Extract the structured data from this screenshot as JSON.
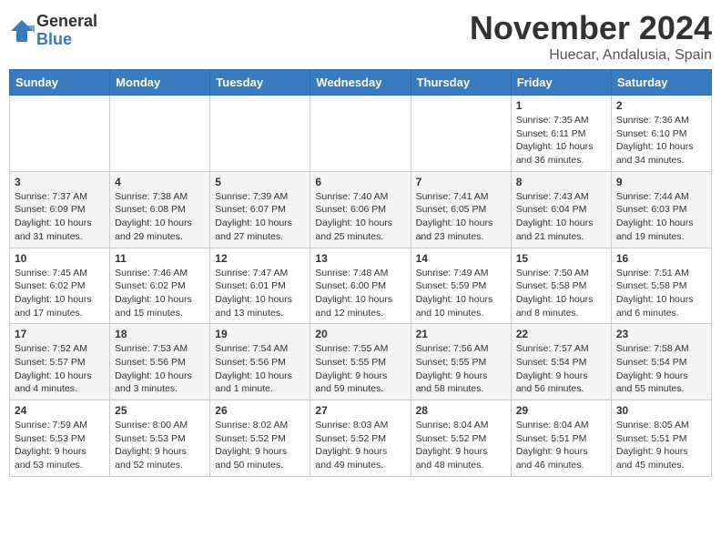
{
  "header": {
    "logo_general": "General",
    "logo_blue": "Blue",
    "month": "November 2024",
    "location": "Huecar, Andalusia, Spain"
  },
  "days_of_week": [
    "Sunday",
    "Monday",
    "Tuesday",
    "Wednesday",
    "Thursday",
    "Friday",
    "Saturday"
  ],
  "weeks": [
    [
      {
        "day": "",
        "info": ""
      },
      {
        "day": "",
        "info": ""
      },
      {
        "day": "",
        "info": ""
      },
      {
        "day": "",
        "info": ""
      },
      {
        "day": "",
        "info": ""
      },
      {
        "day": "1",
        "info": "Sunrise: 7:35 AM\nSunset: 6:11 PM\nDaylight: 10 hours and 36 minutes."
      },
      {
        "day": "2",
        "info": "Sunrise: 7:36 AM\nSunset: 6:10 PM\nDaylight: 10 hours and 34 minutes."
      }
    ],
    [
      {
        "day": "3",
        "info": "Sunrise: 7:37 AM\nSunset: 6:09 PM\nDaylight: 10 hours and 31 minutes."
      },
      {
        "day": "4",
        "info": "Sunrise: 7:38 AM\nSunset: 6:08 PM\nDaylight: 10 hours and 29 minutes."
      },
      {
        "day": "5",
        "info": "Sunrise: 7:39 AM\nSunset: 6:07 PM\nDaylight: 10 hours and 27 minutes."
      },
      {
        "day": "6",
        "info": "Sunrise: 7:40 AM\nSunset: 6:06 PM\nDaylight: 10 hours and 25 minutes."
      },
      {
        "day": "7",
        "info": "Sunrise: 7:41 AM\nSunset: 6:05 PM\nDaylight: 10 hours and 23 minutes."
      },
      {
        "day": "8",
        "info": "Sunrise: 7:43 AM\nSunset: 6:04 PM\nDaylight: 10 hours and 21 minutes."
      },
      {
        "day": "9",
        "info": "Sunrise: 7:44 AM\nSunset: 6:03 PM\nDaylight: 10 hours and 19 minutes."
      }
    ],
    [
      {
        "day": "10",
        "info": "Sunrise: 7:45 AM\nSunset: 6:02 PM\nDaylight: 10 hours and 17 minutes."
      },
      {
        "day": "11",
        "info": "Sunrise: 7:46 AM\nSunset: 6:02 PM\nDaylight: 10 hours and 15 minutes."
      },
      {
        "day": "12",
        "info": "Sunrise: 7:47 AM\nSunset: 6:01 PM\nDaylight: 10 hours and 13 minutes."
      },
      {
        "day": "13",
        "info": "Sunrise: 7:48 AM\nSunset: 6:00 PM\nDaylight: 10 hours and 12 minutes."
      },
      {
        "day": "14",
        "info": "Sunrise: 7:49 AM\nSunset: 5:59 PM\nDaylight: 10 hours and 10 minutes."
      },
      {
        "day": "15",
        "info": "Sunrise: 7:50 AM\nSunset: 5:58 PM\nDaylight: 10 hours and 8 minutes."
      },
      {
        "day": "16",
        "info": "Sunrise: 7:51 AM\nSunset: 5:58 PM\nDaylight: 10 hours and 6 minutes."
      }
    ],
    [
      {
        "day": "17",
        "info": "Sunrise: 7:52 AM\nSunset: 5:57 PM\nDaylight: 10 hours and 4 minutes."
      },
      {
        "day": "18",
        "info": "Sunrise: 7:53 AM\nSunset: 5:56 PM\nDaylight: 10 hours and 3 minutes."
      },
      {
        "day": "19",
        "info": "Sunrise: 7:54 AM\nSunset: 5:56 PM\nDaylight: 10 hours and 1 minute."
      },
      {
        "day": "20",
        "info": "Sunrise: 7:55 AM\nSunset: 5:55 PM\nDaylight: 9 hours and 59 minutes."
      },
      {
        "day": "21",
        "info": "Sunrise: 7:56 AM\nSunset: 5:55 PM\nDaylight: 9 hours and 58 minutes."
      },
      {
        "day": "22",
        "info": "Sunrise: 7:57 AM\nSunset: 5:54 PM\nDaylight: 9 hours and 56 minutes."
      },
      {
        "day": "23",
        "info": "Sunrise: 7:58 AM\nSunset: 5:54 PM\nDaylight: 9 hours and 55 minutes."
      }
    ],
    [
      {
        "day": "24",
        "info": "Sunrise: 7:59 AM\nSunset: 5:53 PM\nDaylight: 9 hours and 53 minutes."
      },
      {
        "day": "25",
        "info": "Sunrise: 8:00 AM\nSunset: 5:53 PM\nDaylight: 9 hours and 52 minutes."
      },
      {
        "day": "26",
        "info": "Sunrise: 8:02 AM\nSunset: 5:52 PM\nDaylight: 9 hours and 50 minutes."
      },
      {
        "day": "27",
        "info": "Sunrise: 8:03 AM\nSunset: 5:52 PM\nDaylight: 9 hours and 49 minutes."
      },
      {
        "day": "28",
        "info": "Sunrise: 8:04 AM\nSunset: 5:52 PM\nDaylight: 9 hours and 48 minutes."
      },
      {
        "day": "29",
        "info": "Sunrise: 8:04 AM\nSunset: 5:51 PM\nDaylight: 9 hours and 46 minutes."
      },
      {
        "day": "30",
        "info": "Sunrise: 8:05 AM\nSunset: 5:51 PM\nDaylight: 9 hours and 45 minutes."
      }
    ]
  ]
}
